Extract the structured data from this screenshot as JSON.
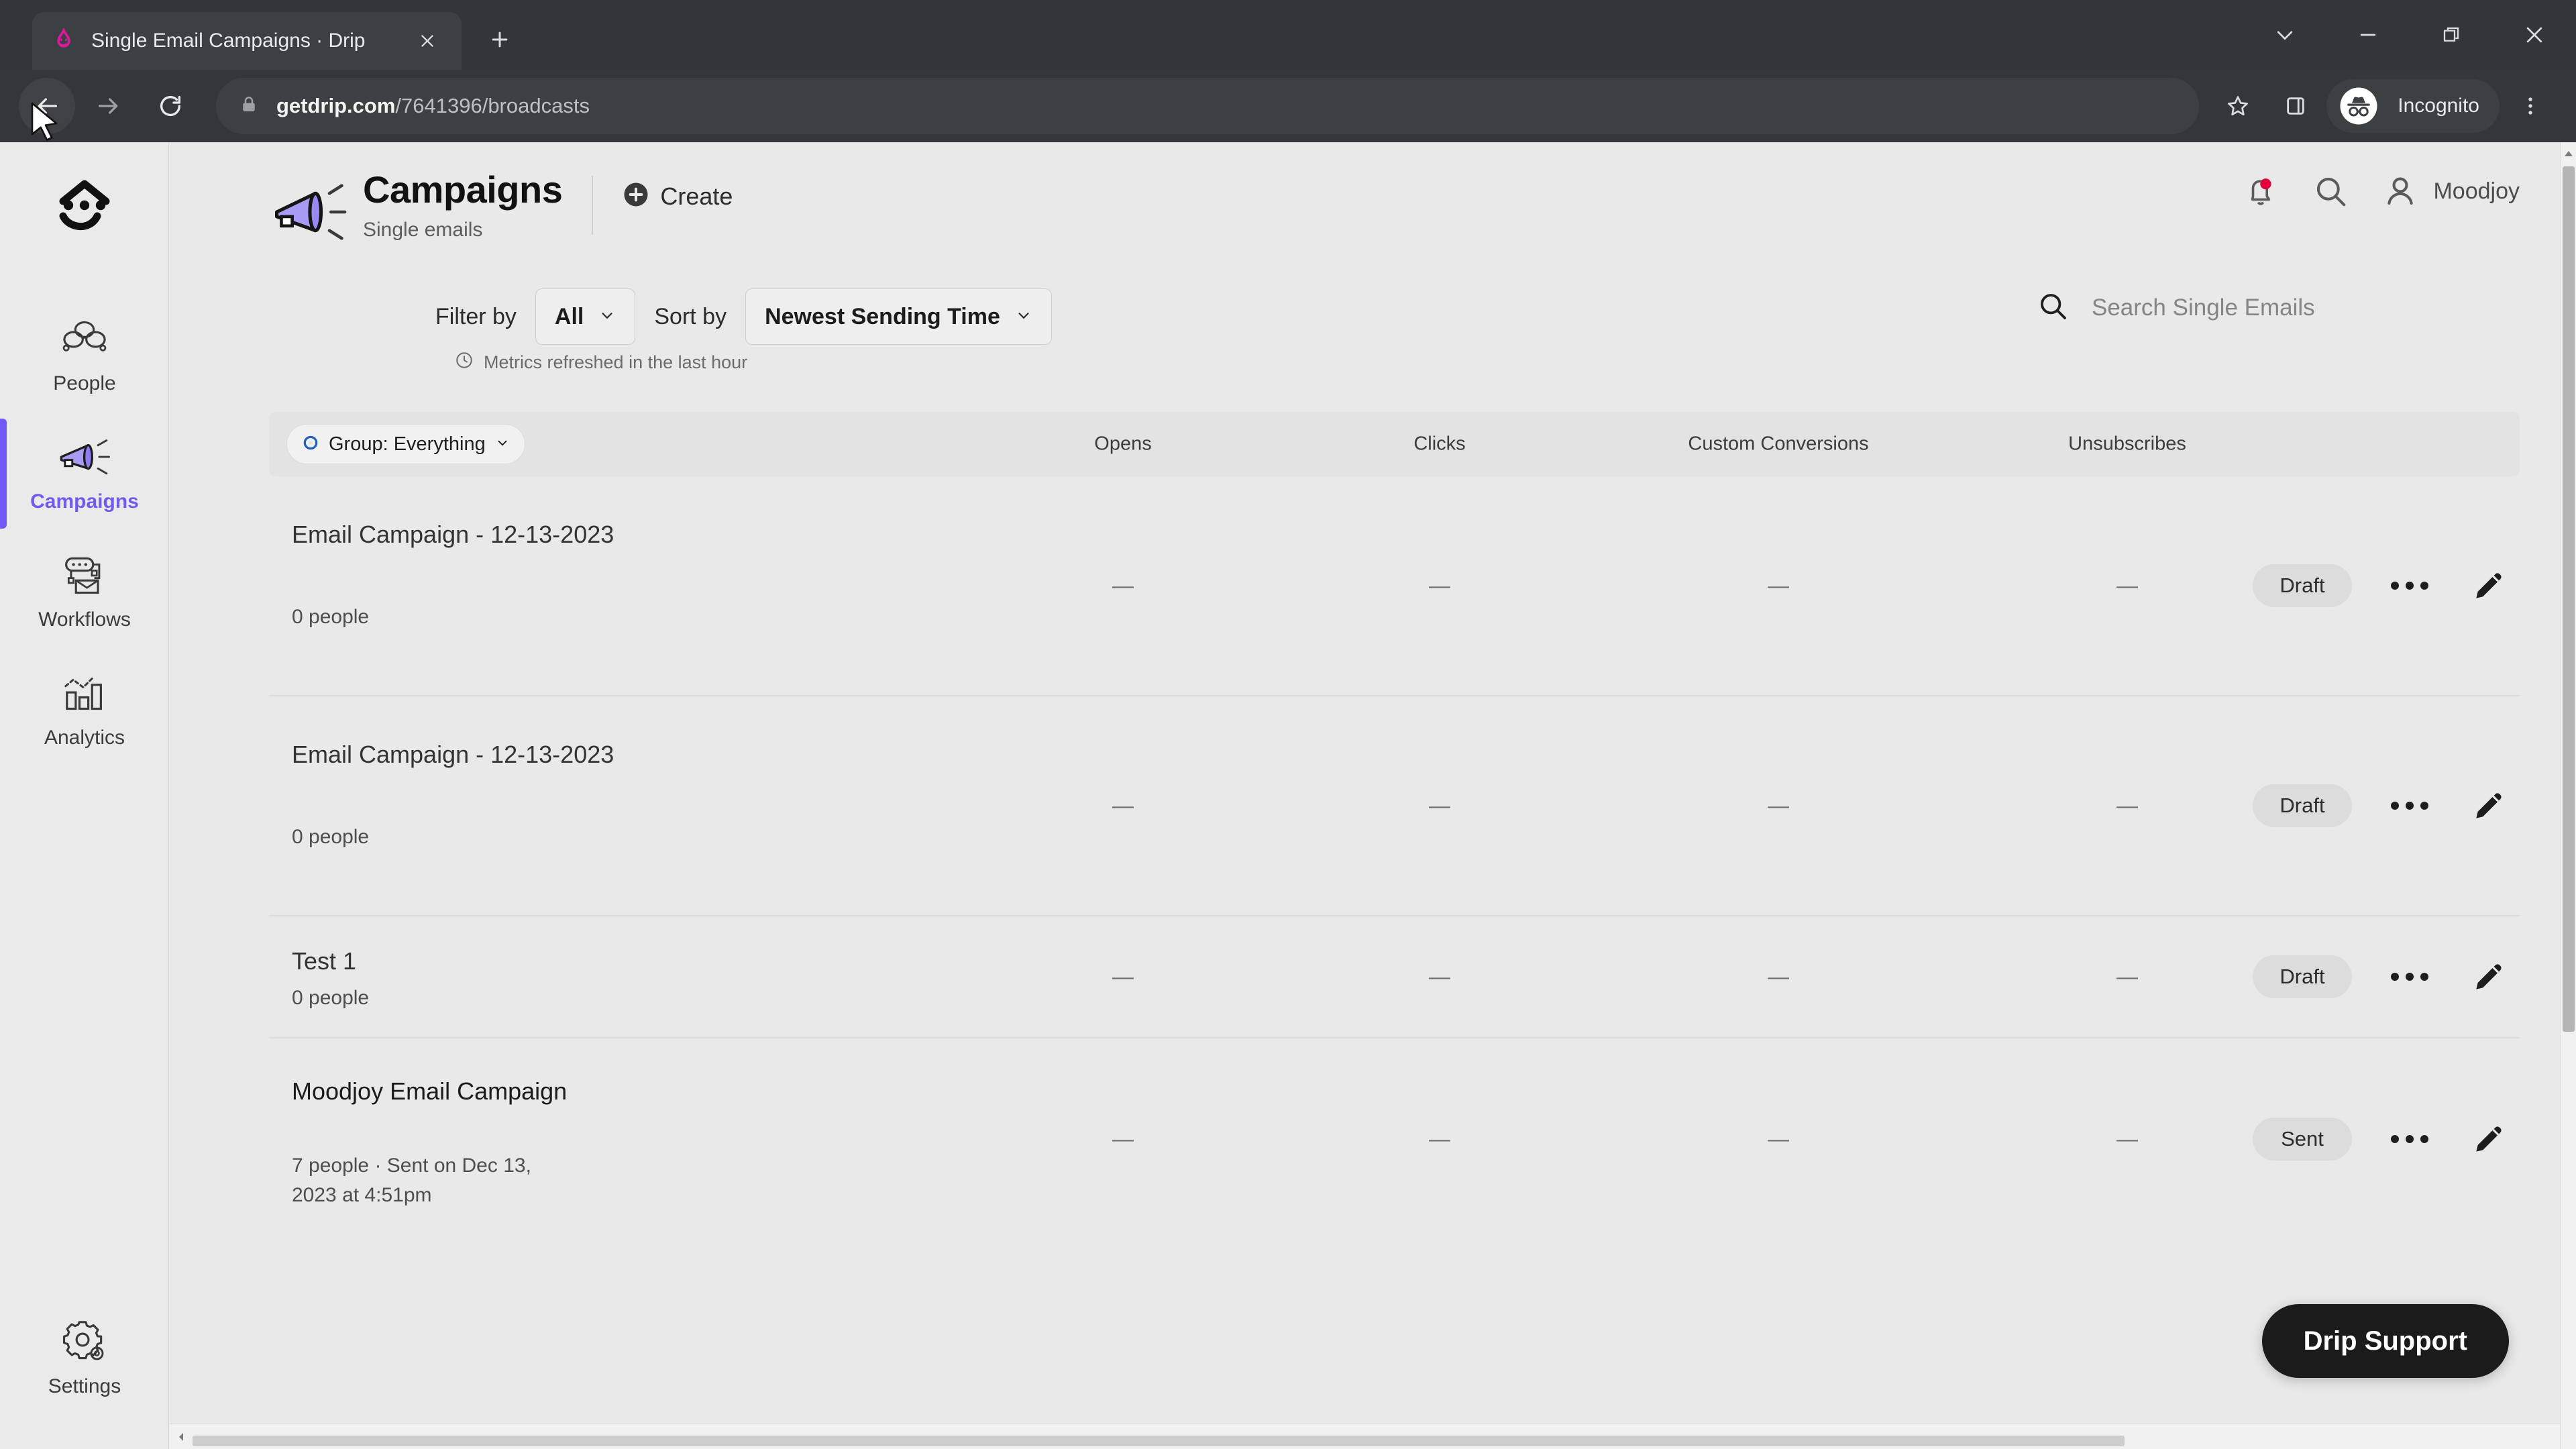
{
  "browser": {
    "tab": {
      "title": "Single Email Campaigns · Drip",
      "favicon": "drip-logo-icon",
      "close": "close-icon"
    },
    "new_tab": "new-tab-icon",
    "window_controls": [
      "tab-search-chevron",
      "minimize",
      "restore",
      "close"
    ],
    "nav": {
      "back": "back-arrow-icon",
      "forward": "forward-arrow-icon",
      "reload": "reload-icon"
    },
    "omnibox": {
      "lock": "lock-icon",
      "url_domain": "getdrip.com",
      "url_path": "/7641396/broadcasts",
      "bookmark": "star-icon"
    },
    "toolbar_right": {
      "side_panel": "side-panel-icon",
      "profile_icon": "incognito-icon",
      "profile_label": "Incognito",
      "menu": "kebab-menu-icon"
    }
  },
  "sidebar": {
    "logo": "drip-face-logo",
    "items": [
      {
        "label": "People",
        "icon": "people-icon",
        "selected": false
      },
      {
        "label": "Campaigns",
        "icon": "megaphone-icon",
        "selected": true
      },
      {
        "label": "Workflows",
        "icon": "workflow-icon",
        "selected": false
      },
      {
        "label": "Analytics",
        "icon": "bar-chart-icon",
        "selected": false
      }
    ],
    "settings": {
      "label": "Settings",
      "icon": "gear-icon"
    },
    "accent": "#7059f5"
  },
  "header": {
    "icon": "megaphone-icon",
    "title": "Campaigns",
    "subtitle": "Single emails",
    "create_label": "Create",
    "create_icon": "plus-circle-icon",
    "notifications_icon": "bell-icon",
    "notifications_dot_color": "#e0003c",
    "search_icon": "search-icon",
    "user_icon": "user-icon",
    "user_name": "Moodjoy"
  },
  "filters": {
    "filter_label": "Filter by",
    "filter_value": "All",
    "sort_label": "Sort by",
    "sort_value": "Newest Sending Time",
    "metrics_note": "Metrics refreshed in the last hour",
    "metrics_icon": "clock-icon",
    "chevron_icon": "chevron-down-icon"
  },
  "search": {
    "icon": "search-icon",
    "placeholder": "Search Single Emails",
    "value": ""
  },
  "table": {
    "group_chip": {
      "icon": "group-target-icon",
      "label": "Group: Everything",
      "chevron": "chevron-down-icon"
    },
    "columns": [
      "Opens",
      "Clicks",
      "Custom Conversions",
      "Unsubscribes"
    ],
    "rows": [
      {
        "name": "Email Campaign - 12-13-2023",
        "meta": "0 people",
        "metrics": [
          "—",
          "—",
          "—",
          "—"
        ],
        "status": "Draft",
        "more_icon": "more-dots-icon",
        "edit_icon": "pencil-icon"
      },
      {
        "name": "Email Campaign - 12-13-2023",
        "meta": "0 people",
        "metrics": [
          "—",
          "—",
          "—",
          "—"
        ],
        "status": "Draft",
        "more_icon": "more-dots-icon",
        "edit_icon": "pencil-icon"
      },
      {
        "name": "Test 1",
        "meta": "0 people",
        "metrics": [
          "—",
          "—",
          "—",
          "—"
        ],
        "status": "Draft",
        "more_icon": "more-dots-icon",
        "edit_icon": "pencil-icon"
      },
      {
        "name": "Moodjoy Email Campaign",
        "meta": "7 people · Sent on Dec 13, 2023 at 4:51pm",
        "metrics": [
          "—",
          "—",
          "—",
          "—"
        ],
        "status": "Sent",
        "more_icon": "more-dots-icon",
        "edit_icon": "pencil-icon"
      }
    ]
  },
  "support": {
    "label": "Drip Support"
  }
}
